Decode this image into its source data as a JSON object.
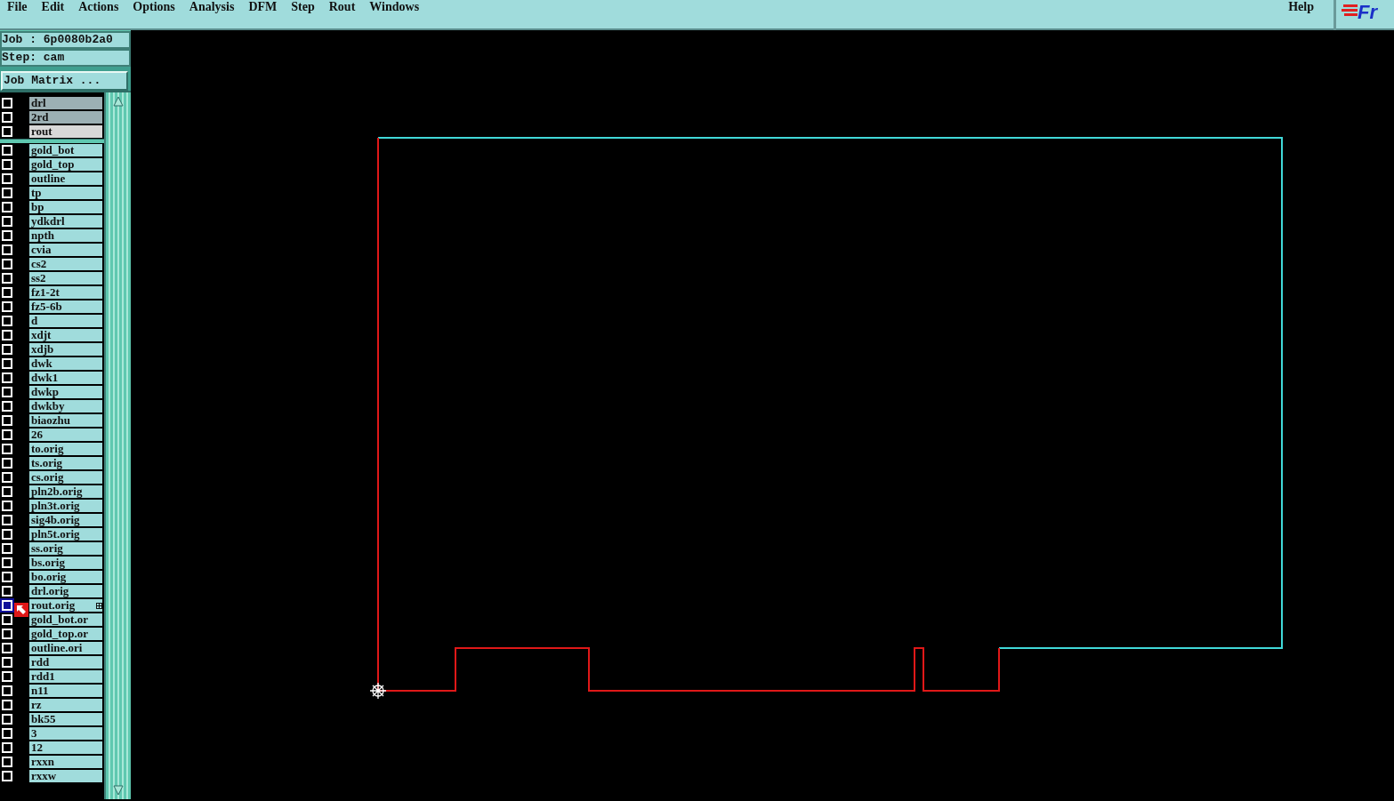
{
  "menu": [
    {
      "label": "File"
    },
    {
      "label": "Edit"
    },
    {
      "label": "Actions"
    },
    {
      "label": "Options"
    },
    {
      "label": "Analysis"
    },
    {
      "label": "DFM"
    },
    {
      "label": "Step"
    },
    {
      "label": "Rout"
    },
    {
      "label": "Windows"
    }
  ],
  "help": "Help",
  "logo": "Fr",
  "job": "Job : 6p0080b2a0",
  "step": "Step: cam",
  "job_matrix_button": "Job Matrix ...",
  "layer_groups": [
    {
      "layers": [
        {
          "name": "drl",
          "color": "#9cb0b4",
          "affected": false,
          "work": false
        },
        {
          "name": "2rd",
          "color": "#9cb0b4",
          "affected": false,
          "work": false
        },
        {
          "name": "rout",
          "color": "#d8d8d8",
          "affected": false,
          "work": false
        }
      ]
    },
    {
      "layers": [
        {
          "name": "gold_bot",
          "color": "#a0dcdc",
          "affected": false,
          "work": false
        },
        {
          "name": "gold_top",
          "color": "#a0dcdc",
          "affected": false,
          "work": false
        },
        {
          "name": "outline",
          "color": "#a0dcdc",
          "affected": false,
          "work": false
        },
        {
          "name": "tp",
          "color": "#a0dcdc",
          "affected": false,
          "work": false
        },
        {
          "name": "bp",
          "color": "#a0dcdc",
          "affected": false,
          "work": false
        },
        {
          "name": "ydkdrl",
          "color": "#a0dcdc",
          "affected": false,
          "work": false
        },
        {
          "name": "npth",
          "color": "#a0dcdc",
          "affected": false,
          "work": false
        },
        {
          "name": "cvia",
          "color": "#a0dcdc",
          "affected": false,
          "work": false
        },
        {
          "name": "cs2",
          "color": "#a0dcdc",
          "affected": false,
          "work": false
        },
        {
          "name": "ss2",
          "color": "#a0dcdc",
          "affected": false,
          "work": false
        },
        {
          "name": "fz1-2t",
          "color": "#a0dcdc",
          "affected": false,
          "work": false
        },
        {
          "name": "fz5-6b",
          "color": "#a0dcdc",
          "affected": false,
          "work": false
        },
        {
          "name": "d",
          "color": "#a0dcdc",
          "affected": false,
          "work": false
        },
        {
          "name": "xdjt",
          "color": "#a0dcdc",
          "affected": false,
          "work": false
        },
        {
          "name": "xdjb",
          "color": "#a0dcdc",
          "affected": false,
          "work": false
        },
        {
          "name": "dwk",
          "color": "#a0dcdc",
          "affected": false,
          "work": false
        },
        {
          "name": "dwk1",
          "color": "#a0dcdc",
          "affected": false,
          "work": false
        },
        {
          "name": "dwkp",
          "color": "#a0dcdc",
          "affected": false,
          "work": false
        },
        {
          "name": "dwkby",
          "color": "#a0dcdc",
          "affected": false,
          "work": false
        },
        {
          "name": "biaozhu",
          "color": "#a0dcdc",
          "affected": false,
          "work": false
        },
        {
          "name": "26",
          "color": "#a0dcdc",
          "affected": false,
          "work": false
        },
        {
          "name": "to.orig",
          "color": "#a0dcdc",
          "affected": false,
          "work": false
        },
        {
          "name": "ts.orig",
          "color": "#a0dcdc",
          "affected": false,
          "work": false
        },
        {
          "name": "cs.orig",
          "color": "#a0dcdc",
          "affected": false,
          "work": false
        },
        {
          "name": "pln2b.orig",
          "color": "#a0dcdc",
          "affected": false,
          "work": false
        },
        {
          "name": "pln3t.orig",
          "color": "#a0dcdc",
          "affected": false,
          "work": false
        },
        {
          "name": "sig4b.orig",
          "color": "#a0dcdc",
          "affected": false,
          "work": false
        },
        {
          "name": "pln5t.orig",
          "color": "#a0dcdc",
          "affected": false,
          "work": false
        },
        {
          "name": "ss.orig",
          "color": "#a0dcdc",
          "affected": false,
          "work": false
        },
        {
          "name": "bs.orig",
          "color": "#a0dcdc",
          "affected": false,
          "work": false
        },
        {
          "name": "bo.orig",
          "color": "#a0dcdc",
          "affected": false,
          "work": false
        },
        {
          "name": "drl.orig",
          "color": "#a0dcdc",
          "affected": false,
          "work": false
        },
        {
          "name": "rout.orig",
          "color": "#a0dcdc",
          "affected": true,
          "work": true
        },
        {
          "name": "gold_bot.or",
          "color": "#a0dcdc",
          "affected": false,
          "work": false
        },
        {
          "name": "gold_top.or",
          "color": "#a0dcdc",
          "affected": false,
          "work": false
        },
        {
          "name": "outline.ori",
          "color": "#a0dcdc",
          "affected": false,
          "work": false
        },
        {
          "name": "rdd",
          "color": "#a0dcdc",
          "affected": false,
          "work": false
        },
        {
          "name": "rdd1",
          "color": "#a0dcdc",
          "affected": false,
          "work": false
        },
        {
          "name": "n11",
          "color": "#a0dcdc",
          "affected": false,
          "work": false
        },
        {
          "name": "rz",
          "color": "#a0dcdc",
          "affected": false,
          "work": false
        },
        {
          "name": "bk55",
          "color": "#a0dcdc",
          "affected": false,
          "work": false
        },
        {
          "name": "3",
          "color": "#a0dcdc",
          "affected": false,
          "work": false
        },
        {
          "name": "12",
          "color": "#a0dcdc",
          "affected": false,
          "work": false
        },
        {
          "name": "rxxn",
          "color": "#a0dcdc",
          "affected": false,
          "work": false
        },
        {
          "name": "rxxw",
          "color": "#a0dcdc",
          "affected": false,
          "work": false
        }
      ]
    }
  ]
}
